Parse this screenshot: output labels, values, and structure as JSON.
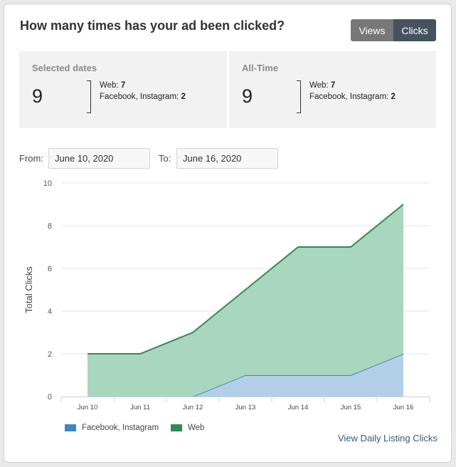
{
  "header": {
    "title": "How many times has your ad been clicked?"
  },
  "toggle": {
    "views_label": "Views",
    "clicks_label": "Clicks",
    "active": "Clicks"
  },
  "stats": {
    "selected": {
      "label": "Selected dates",
      "total": "9",
      "web_label": "Web:",
      "web_value": "7",
      "social_label": "Facebook, Instagram:",
      "social_value": "2"
    },
    "alltime": {
      "label": "All-Time",
      "total": "9",
      "web_label": "Web:",
      "web_value": "7",
      "social_label": "Facebook, Instagram:",
      "social_value": "2"
    }
  },
  "dates": {
    "from_label": "From:",
    "from_value": "June 10, 2020",
    "to_label": "To:",
    "to_value": "June 16, 2020"
  },
  "chart_data": {
    "type": "area",
    "stacked": true,
    "categories": [
      "Jun 10",
      "Jun 11",
      "Jun 12",
      "Jun 13",
      "Jun 14",
      "Jun 15",
      "Jun 16"
    ],
    "series": [
      {
        "name": "Facebook, Instagram",
        "values": [
          0,
          0,
          0,
          1,
          1,
          1,
          2
        ],
        "color": "#3b87c4",
        "fill": "#b3cfe8"
      },
      {
        "name": "Web",
        "values": [
          2,
          2,
          3,
          4,
          6,
          6,
          7
        ],
        "color": "#2e8b57",
        "fill": "#a9d6be"
      }
    ],
    "ylabel": "Total Clicks",
    "ylim": [
      0,
      10
    ],
    "yticks": [
      0,
      2,
      4,
      6,
      8,
      10
    ],
    "grid": true,
    "legend": "bottom-left"
  },
  "footer": {
    "link_label": "View Daily Listing Clicks"
  }
}
